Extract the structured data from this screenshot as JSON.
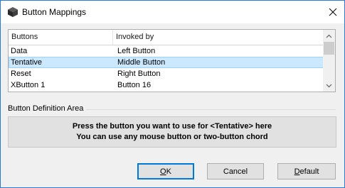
{
  "window": {
    "title": "Button Mappings",
    "close_glyph": "✕",
    "accent_color": "#2b7bd0"
  },
  "list": {
    "headers": [
      "Buttons",
      "Invoked by"
    ],
    "rows": [
      {
        "button": "Data",
        "invoked_by": "Left Button",
        "selected": false
      },
      {
        "button": "Tentative",
        "invoked_by": "Middle Button",
        "selected": true
      },
      {
        "button": "Reset",
        "invoked_by": "Right Button",
        "selected": false
      },
      {
        "button": "XButton 1",
        "invoked_by": "Button 16",
        "selected": false
      }
    ],
    "selection_color": "#cce8ff"
  },
  "definition": {
    "group_label": "Button Definition Area",
    "line1": "Press the button you want to use for <Tentative> here",
    "line2": "You can use any mouse button or two-button chord"
  },
  "buttons": {
    "ok": "OK",
    "cancel": "Cancel",
    "default": "Default"
  }
}
